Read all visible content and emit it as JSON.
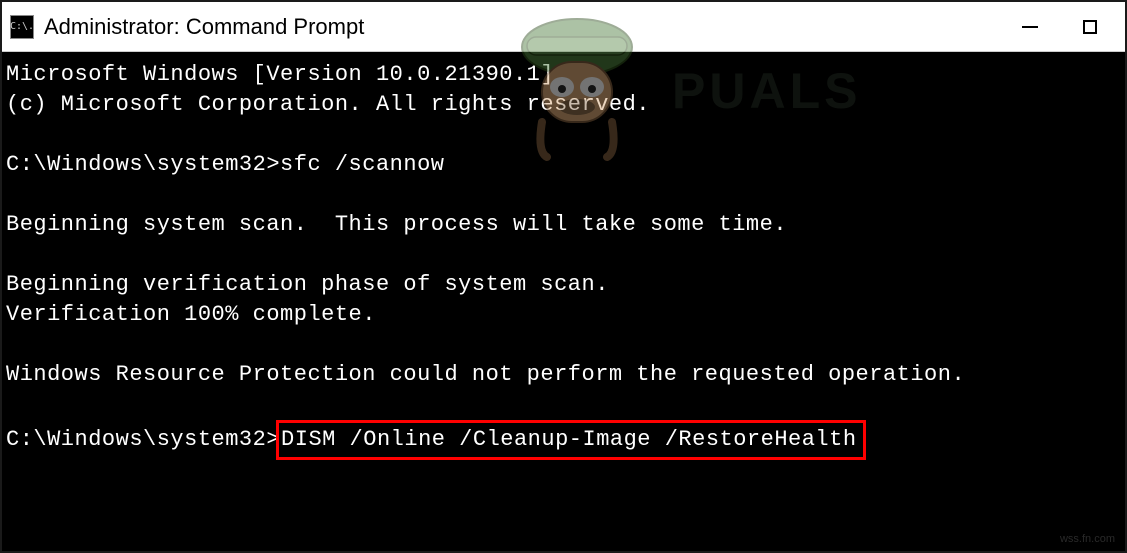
{
  "window": {
    "title": "Administrator: Command Prompt",
    "icon_label": "C:\\."
  },
  "terminal": {
    "line1": "Microsoft Windows [Version 10.0.21390.1]",
    "line2": "(c) Microsoft Corporation. All rights reserved.",
    "prompt1_path": "C:\\Windows\\system32>",
    "prompt1_cmd": "sfc /scannow",
    "line_scan": "Beginning system scan.  This process will take some time.",
    "line_verif1": "Beginning verification phase of system scan.",
    "line_verif2": "Verification 100% complete.",
    "line_result": "Windows Resource Protection could not perform the requested operation.",
    "prompt2_path": "C:\\Windows\\system32>",
    "prompt2_cmd": "DISM /Online /Cleanup-Image /RestoreHealth"
  },
  "watermark": {
    "brand": "PUALS",
    "site": "wss.fn.com"
  }
}
